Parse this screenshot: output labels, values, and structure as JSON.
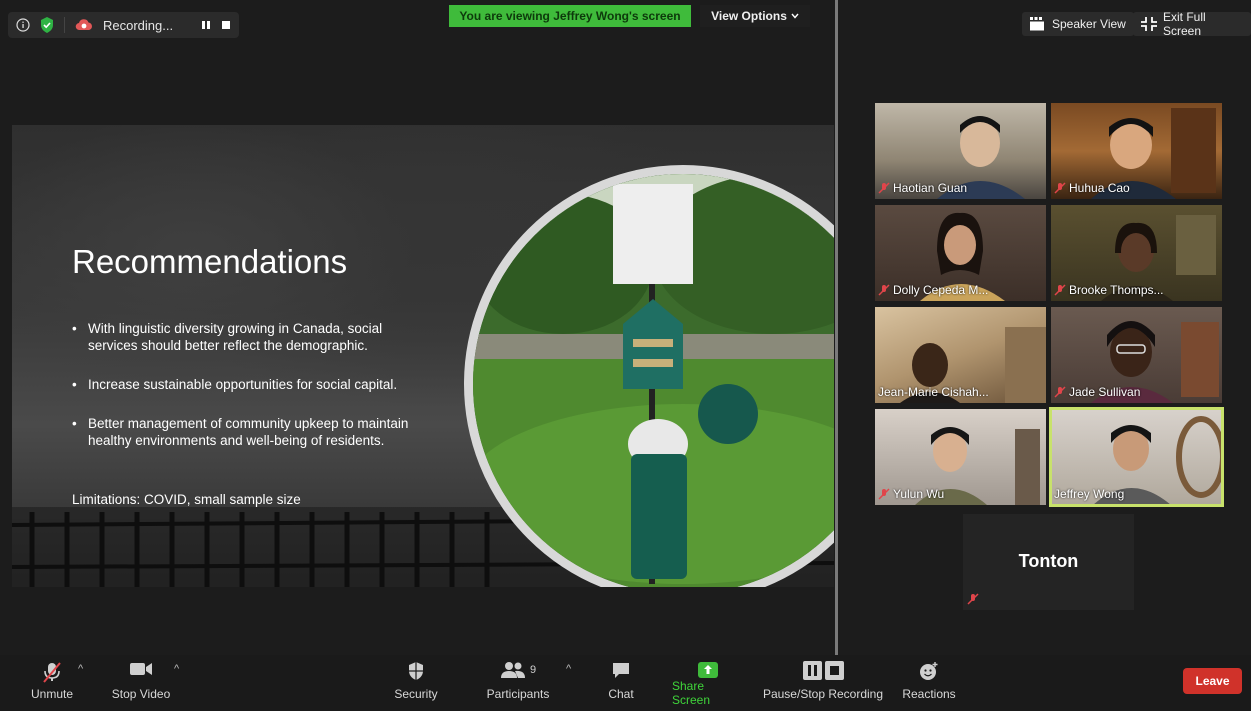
{
  "recording": {
    "label": "Recording..."
  },
  "banner": {
    "text": "You are viewing Jeffrey Wong's screen",
    "view_options": "View Options"
  },
  "top_right": {
    "speaker_view": "Speaker View",
    "exit_full_screen": "Exit Full Screen"
  },
  "slide": {
    "title": "Recommendations",
    "bullets": [
      "With linguistic diversity growing in Canada, social services should better reflect the demographic.",
      "Increase sustainable opportunities for social capital.",
      "Better management of community upkeep to maintain healthy environments and well-being of residents."
    ],
    "limitations": "Limitations: COVID, small sample size"
  },
  "participants": [
    {
      "name": "Haotian Guan",
      "muted": true
    },
    {
      "name": "Huhua Cao",
      "muted": true
    },
    {
      "name": "Dolly Cepeda M...",
      "muted": true
    },
    {
      "name": "Brooke Thomps...",
      "muted": true
    },
    {
      "name": "Jean-Marie Cishah...",
      "muted": false
    },
    {
      "name": "Jade Sullivan",
      "muted": true
    },
    {
      "name": "Yulun Wu",
      "muted": true
    },
    {
      "name": "Jeffrey Wong",
      "muted": false,
      "active_speaker": true
    },
    {
      "name": "Tonton",
      "muted": true
    }
  ],
  "toolbar": {
    "unmute": "Unmute",
    "stop_video": "Stop Video",
    "security": "Security",
    "participants": "Participants",
    "participants_count": "9",
    "chat": "Chat",
    "share_screen": "Share Screen",
    "pause_stop_recording": "Pause/Stop Recording",
    "reactions": "Reactions",
    "leave": "Leave"
  },
  "colors": {
    "share_green": "#3fbb3b",
    "leave_red": "#d0322a",
    "active_speaker": "#c8e26b",
    "muted_red": "#e0454a"
  }
}
